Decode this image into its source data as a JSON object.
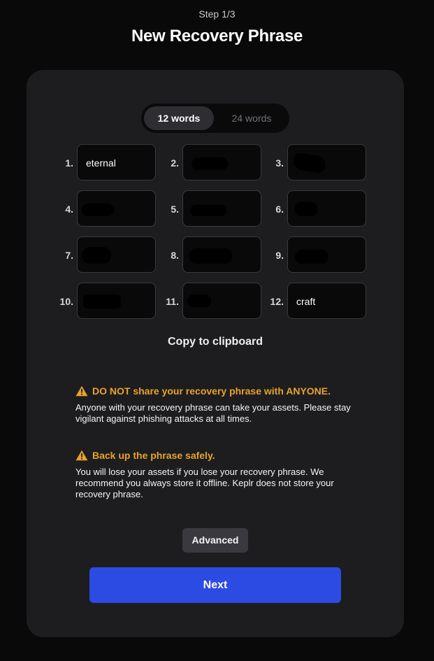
{
  "header": {
    "step": "Step 1/3",
    "title": "New Recovery Phrase"
  },
  "toggle": {
    "options": [
      "12 words",
      "24 words"
    ],
    "selected": "12 words"
  },
  "words": [
    {
      "num": "1.",
      "value": "eternal"
    },
    {
      "num": "2.",
      "value": ""
    },
    {
      "num": "3.",
      "value": ""
    },
    {
      "num": "4.",
      "value": ""
    },
    {
      "num": "5.",
      "value": ""
    },
    {
      "num": "6.",
      "value": ""
    },
    {
      "num": "7.",
      "value": ""
    },
    {
      "num": "8.",
      "value": ""
    },
    {
      "num": "9.",
      "value": ""
    },
    {
      "num": "10.",
      "value": ""
    },
    {
      "num": "11.",
      "value": ""
    },
    {
      "num": "12.",
      "value": "craft"
    }
  ],
  "copy_label": "Copy to clipboard",
  "warnings": [
    {
      "title": "DO NOT share your recovery phrase with ANYONE.",
      "body": "Anyone with your recovery phrase can take your assets. Please stay vigilant against phishing attacks at all times."
    },
    {
      "title": "Back up the phrase safely.",
      "body": "You will lose your assets if you lose your recovery phrase. We recommend you always store it offline. Keplr does not store your recovery phrase."
    }
  ],
  "advanced_label": "Advanced",
  "next_label": "Next",
  "colors": {
    "accent": "#2c4be2",
    "warning": "#e8a32a",
    "card": "#1d1d1f",
    "background": "#09090a"
  }
}
